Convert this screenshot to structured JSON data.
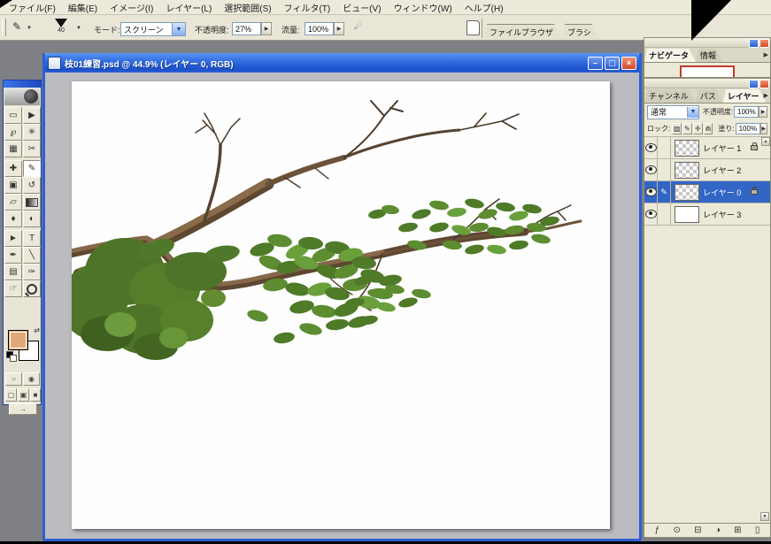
{
  "menu_bar": {
    "items": [
      "ファイル(F)",
      "編集(E)",
      "イメージ(I)",
      "レイヤー(L)",
      "選択範囲(S)",
      "フィルタ(T)",
      "ビュー(V)",
      "ウィンドウ(W)",
      "ヘルプ(H)"
    ]
  },
  "options_bar": {
    "brush_size": "40",
    "mode_label": "モード:",
    "mode_value": "スクリーン",
    "opacity_label": "不透明度:",
    "opacity_value": "27%",
    "flow_label": "流量:",
    "flow_value": "100%",
    "palette_well_tabs": [
      "ファイルブラウザ",
      "ブラシ"
    ]
  },
  "document_window": {
    "title": "枝01練習.psd @ 44.9% (レイヤー 0, RGB)",
    "zoom_percent": "44.9%"
  },
  "toolbox": {
    "icons": {
      "marquee": "▭",
      "move": "▶",
      "lasso": "℘",
      "magic_wand": "✳",
      "crop": "▦",
      "slice": "✂",
      "healing_brush": "✚",
      "brush": "✎",
      "clone_stamp": "▣",
      "history_brush": "↺",
      "eraser": "▱",
      "blur": "♦",
      "dodge": "◐",
      "path_selection": "►",
      "type": "T",
      "pen": "✒",
      "line": "╲",
      "notes": "▤",
      "eyedropper": "✑",
      "hand": "☞"
    },
    "foreground_color": "#e0aa78",
    "background_color": "#ffffff"
  },
  "navigator_palette": {
    "tabs": [
      "ナビゲータ",
      "情報"
    ]
  },
  "layers_palette": {
    "tabs": [
      "チャンネル",
      "パス",
      "レイヤー"
    ],
    "blend_mode_value": "通常",
    "opacity_label": "不透明度:",
    "opacity_value": "100%",
    "lock_label": "ロック:",
    "fill_label": "塗り:",
    "fill_value": "100%",
    "lock_icons": {
      "transparency": "▨",
      "paint": "✎",
      "position": "✛",
      "all": "⋒"
    },
    "layers": [
      {
        "name": "レイヤー 1",
        "visible": true,
        "locked": true,
        "selected": false
      },
      {
        "name": "レイヤー 2",
        "visible": true,
        "locked": false,
        "selected": false
      },
      {
        "name": "レイヤー 0",
        "visible": true,
        "locked": true,
        "selected": true,
        "editing": true
      },
      {
        "name": "レイヤー 3",
        "visible": true,
        "locked": false,
        "selected": false
      }
    ],
    "buttons": {
      "layer_style": "ƒ",
      "layer_mask": "⊙",
      "layer_set": "⊟",
      "adjustment_layer": "◑",
      "new_layer": "⊞",
      "delete_layer": "▯"
    }
  },
  "glyphs": {
    "minimize": "–",
    "maximize": "▢",
    "close": "×",
    "panel_arrow": "▶",
    "dropdown": "▼",
    "spinner": "▶",
    "scroll_up": "▲",
    "scroll_down": "▼",
    "airbrush": "☄",
    "swap_colors": "⇄",
    "imageready": "→",
    "standard_mode": "○",
    "quickmask_mode": "◉",
    "screen_std": "▢",
    "screen_full_menu": "▣",
    "screen_full": "■"
  },
  "colors": {
    "app_background": "#7f8084",
    "titlebar_blue": "#2f6ae0",
    "selected_layer_blue": "#3166c5",
    "foreground_swatch": "#e0aa78",
    "leaf_dark": "#4d7428",
    "leaf_mid": "#5d8c31",
    "leaf_light": "#6aa03c",
    "branch_brown": "#86684a"
  }
}
